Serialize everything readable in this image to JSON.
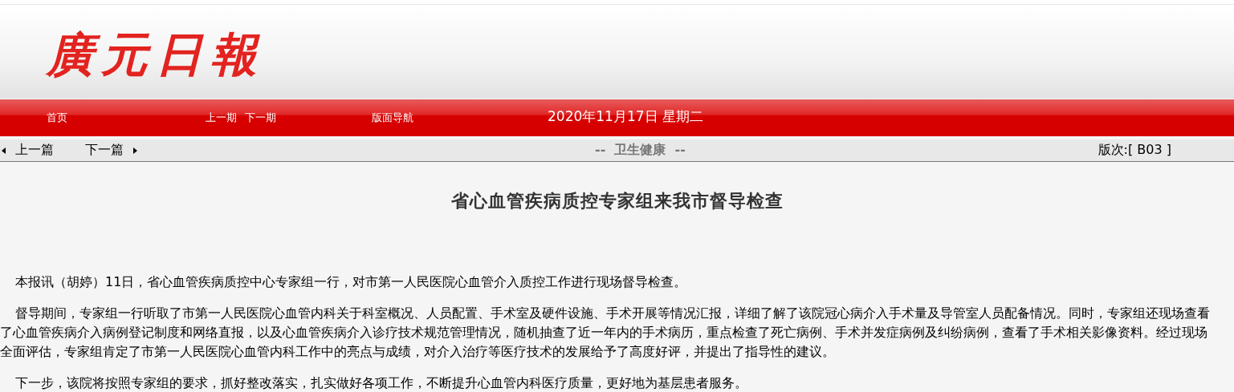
{
  "masthead": {
    "logo": "廣元日報"
  },
  "nav": {
    "links": [
      "首页",
      "上一期",
      "下一期",
      "版面导航"
    ],
    "date": "2020年11月17日 星期二"
  },
  "article_bar": {
    "prev": "上一篇",
    "next": "下一篇",
    "section": "--  卫生健康  --",
    "page": "版次:[ B03 ]"
  },
  "article": {
    "title": "省心血管疾病质控专家组来我市督导检查",
    "paragraphs": [
      "本报讯（胡婷）11日，省心血管疾病质控中心专家组一行，对市第一人民医院心血管介入质控工作进行现场督导检查。",
      "督导期间，专家组一行听取了市第一人民医院心血管内科关于科室概况、人员配置、手术室及硬件设施、手术开展等情况汇报，详细了解了该院冠心病介入手术量及导管室人员配备情况。同时，专家组还现场查看了心血管疾病介入病例登记制度和网络直报，以及心血管疾病介入诊疗技术规范管理情况，随机抽查了近一年内的手术病历，重点检查了死亡病例、手术并发症病例及纠纷病例，查看了手术相关影像资料。经过现场全面评估，专家组肯定了市第一人民医院心血管内科工作中的亮点与成绩，对介入治疗等医疗技术的发展给予了高度好评，并提出了指导性的建议。",
      "下一步，该院将按照专家组的要求，抓好整改落实，扎实做好各项工作，不断提升心血管内科医疗质量，更好地为基层患者服务。"
    ]
  }
}
